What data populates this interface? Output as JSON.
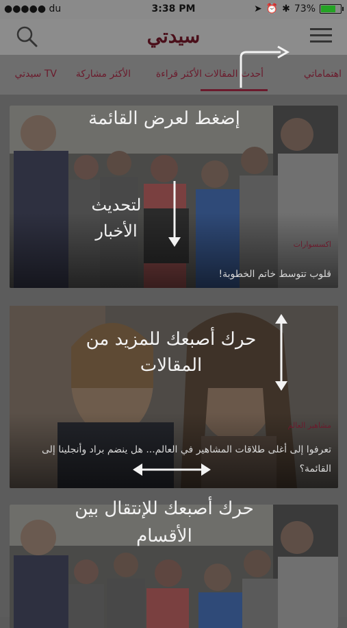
{
  "status_bar": {
    "carrier": "●●●●● du",
    "time": "3:38 PM",
    "battery": "73%"
  },
  "header": {
    "logo": "سيدتي"
  },
  "tabs": [
    {
      "label": "اهتماماتي"
    },
    {
      "label": "أحدث المقالات"
    },
    {
      "label": "الأكثر قراءة"
    },
    {
      "label": "الأكثر مشاركة"
    },
    {
      "label": "سيدتي TV"
    }
  ],
  "articles": [
    {
      "category": "اكسسوارات",
      "title": "قلوب تتوسط خاتم الخطوبة!"
    },
    {
      "category": "مشاهير العالم",
      "title": "تعرفوا إلى أغلى طلاقات المشاهير في العالم... هل ينضم براد وأنجلينا إلى القائمة؟"
    },
    {
      "category": "",
      "title": ""
    }
  ],
  "hints": {
    "menu": "إضغط لعرض القائمة",
    "refresh": "لتحديث الأخبار",
    "scroll": "حرك أصبعك للمزيد من المقالات",
    "swipe": "حرك أصبعك للإنتقال بين الأقسام"
  },
  "colors": {
    "accent": "#6b1a2c",
    "overlay": "#5a5a5a"
  }
}
